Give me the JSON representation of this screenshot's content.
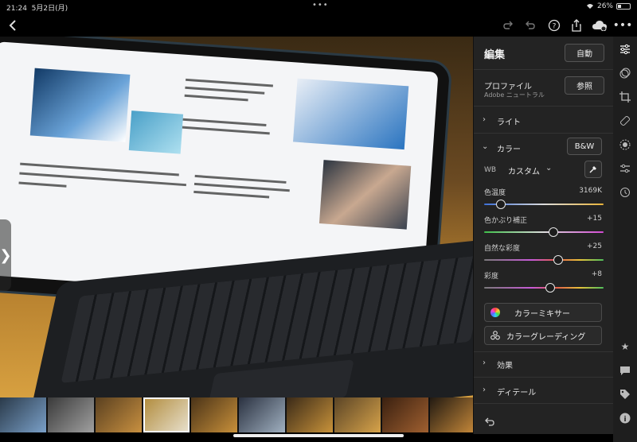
{
  "status": {
    "time": "21:24",
    "date": "5月2日(月)",
    "battery": "26%",
    "battery_fraction": 0.26
  },
  "toolbar": {
    "back_icon": "chevron-left-icon",
    "icons": [
      "redo-icon",
      "undo-icon",
      "help-icon",
      "share-icon",
      "cloud-sync-icon",
      "more-icon"
    ]
  },
  "panel": {
    "title": "編集",
    "auto_button": "自動",
    "profile": {
      "label": "プロファイル",
      "value": "Adobe ニュートラル",
      "browse_button": "参照"
    },
    "light_label": "ライト",
    "color": {
      "label": "カラー",
      "bw_button": "B&W",
      "wb_label": "WB",
      "wb_value": "カスタム",
      "sliders": [
        {
          "label": "色温度",
          "display": "3169K",
          "position": 0.14
        },
        {
          "label": "色かぶり補正",
          "display": "+15",
          "position": 0.58
        },
        {
          "label": "自然な彩度",
          "display": "+25",
          "position": 0.62
        },
        {
          "label": "彩度",
          "display": "+8",
          "position": 0.55
        }
      ],
      "mixer_button": "カラーミキサー",
      "grading_button": "カラーグレーディング"
    },
    "effects_label": "効果",
    "detail_label": "ディテール"
  },
  "rail": {
    "top_icons": [
      "edit-sliders-icon",
      "presets-icon",
      "crop-icon",
      "healing-icon",
      "masking-icon",
      "versions-icon",
      "history-icon"
    ],
    "bottom_icons": [
      "star-icon",
      "comment-icon",
      "tag-icon",
      "info-icon"
    ]
  },
  "filmstrip": {
    "count": 10,
    "selected_index": 3
  },
  "colors": {
    "panel_bg": "#232323",
    "rail_bg": "#1e1e1e",
    "accent": "#ffffff"
  }
}
